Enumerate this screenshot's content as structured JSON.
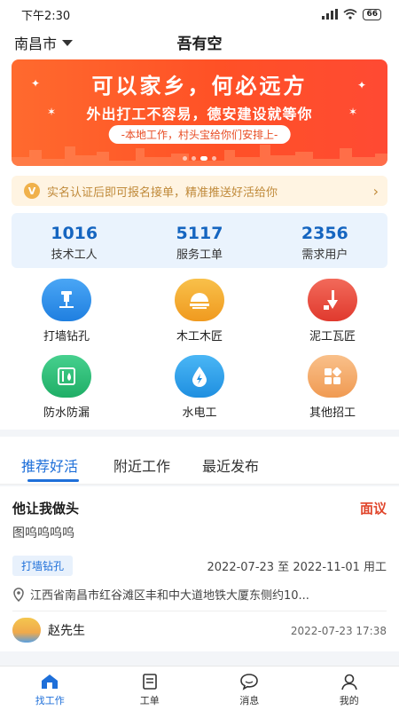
{
  "status": {
    "time": "下午2:30",
    "battery": "66"
  },
  "header": {
    "city": "南昌市",
    "title": "吾有空"
  },
  "banner": {
    "title": "可以家乡，何必远方",
    "subtitle": "外出打工不容易，德安建设就等你",
    "pill": "-本地工作，村头宝给你们安排上-"
  },
  "notice": {
    "text": "实名认证后即可报名接单，精准推送好活给你"
  },
  "stats": [
    {
      "value": "1016",
      "label": "技术工人"
    },
    {
      "value": "5117",
      "label": "服务工单"
    },
    {
      "value": "2356",
      "label": "需求用户"
    }
  ],
  "categories": [
    {
      "label": "打墙钻孔",
      "icon": "drill-icon",
      "color": "#2f8de8"
    },
    {
      "label": "木工木匠",
      "icon": "saw-icon",
      "color": "#f3a52a"
    },
    {
      "label": "泥工瓦匠",
      "icon": "trowel-icon",
      "color": "#ea4a3b"
    },
    {
      "label": "防水防漏",
      "icon": "waterproof-icon",
      "color": "#2fbf7b"
    },
    {
      "label": "水电工",
      "icon": "water-electric-icon",
      "color": "#2f9be8"
    },
    {
      "label": "其他招工",
      "icon": "grid-icon",
      "color": "#f3a463"
    }
  ],
  "tabs": [
    {
      "label": "推荐好活",
      "active": true
    },
    {
      "label": "附近工作",
      "active": false
    },
    {
      "label": "最近发布",
      "active": false
    }
  ],
  "job": {
    "title": "他让我做头",
    "price": "面议",
    "description": "图呜呜呜呜",
    "tag": "打墙钻孔",
    "dates": "2022-07-23 至 2022-11-01 用工",
    "address": "江西省南昌市红谷滩区丰和中大道地铁大厦东侧约10...",
    "user": "赵先生",
    "posted": "2022-07-23 17:38"
  },
  "nav": [
    {
      "label": "找工作",
      "icon": "home-icon",
      "active": true
    },
    {
      "label": "工单",
      "icon": "document-icon",
      "active": false
    },
    {
      "label": "消息",
      "icon": "chat-icon",
      "active": false
    },
    {
      "label": "我的",
      "icon": "user-icon",
      "active": false
    }
  ],
  "colors": {
    "accent": "#1e6fd9",
    "price": "#e0452b",
    "banner": "#ff5a2a"
  }
}
